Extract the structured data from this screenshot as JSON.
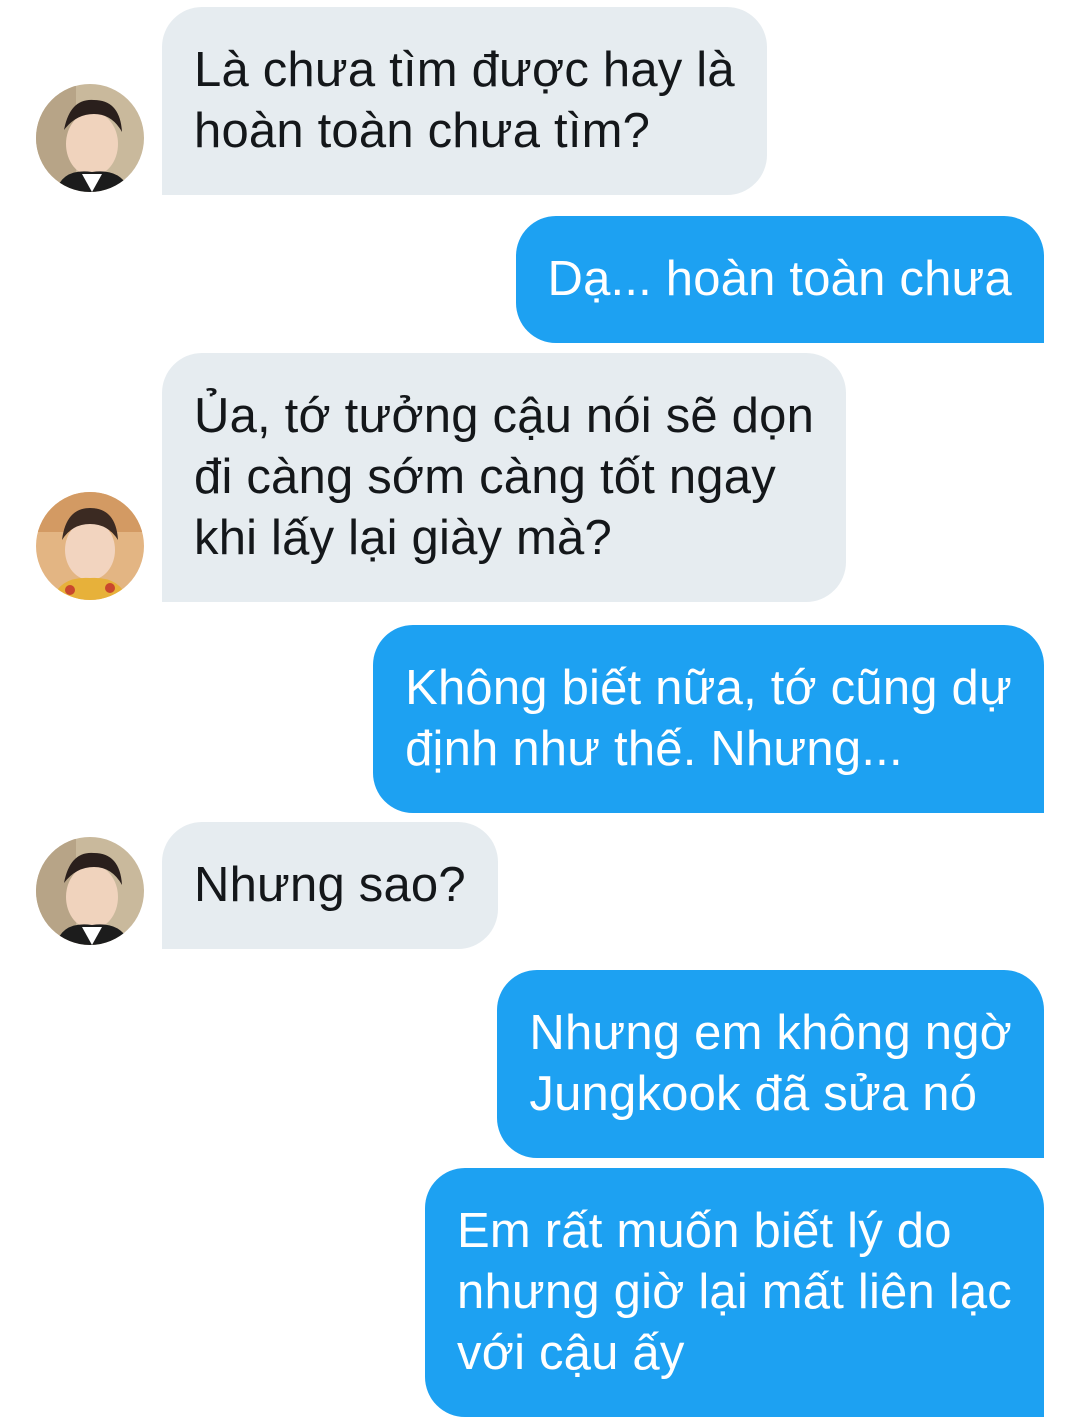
{
  "messages": [
    {
      "from": "them",
      "avatar": "avatar-1",
      "text": "Là chưa tìm được hay là\nhoàn toàn chưa tìm?"
    },
    {
      "from": "me",
      "text": "Dạ... hoàn toàn chưa"
    },
    {
      "from": "them",
      "avatar": "avatar-2",
      "text": "Ủa, tớ tưởng cậu nói sẽ dọn\nđi càng sớm càng tốt ngay\nkhi lấy lại giày mà?"
    },
    {
      "from": "me",
      "text": "Không biết nữa, tớ cũng dự\nđịnh như thế. Nhưng..."
    },
    {
      "from": "them",
      "avatar": "avatar-1",
      "text": "Nhưng sao?"
    },
    {
      "from": "me",
      "text": "Nhưng em không ngờ\nJungkook đã sửa nó"
    },
    {
      "from": "me",
      "text": "Em rất muốn biết lý do\nnhưng giờ lại mất liên lạc\nvới cậu ấy"
    }
  ],
  "colors": {
    "incoming_bubble": "#e6ecf0",
    "incoming_text": "#14171a",
    "outgoing_bubble": "#1da1f2",
    "outgoing_text": "#ffffff"
  }
}
